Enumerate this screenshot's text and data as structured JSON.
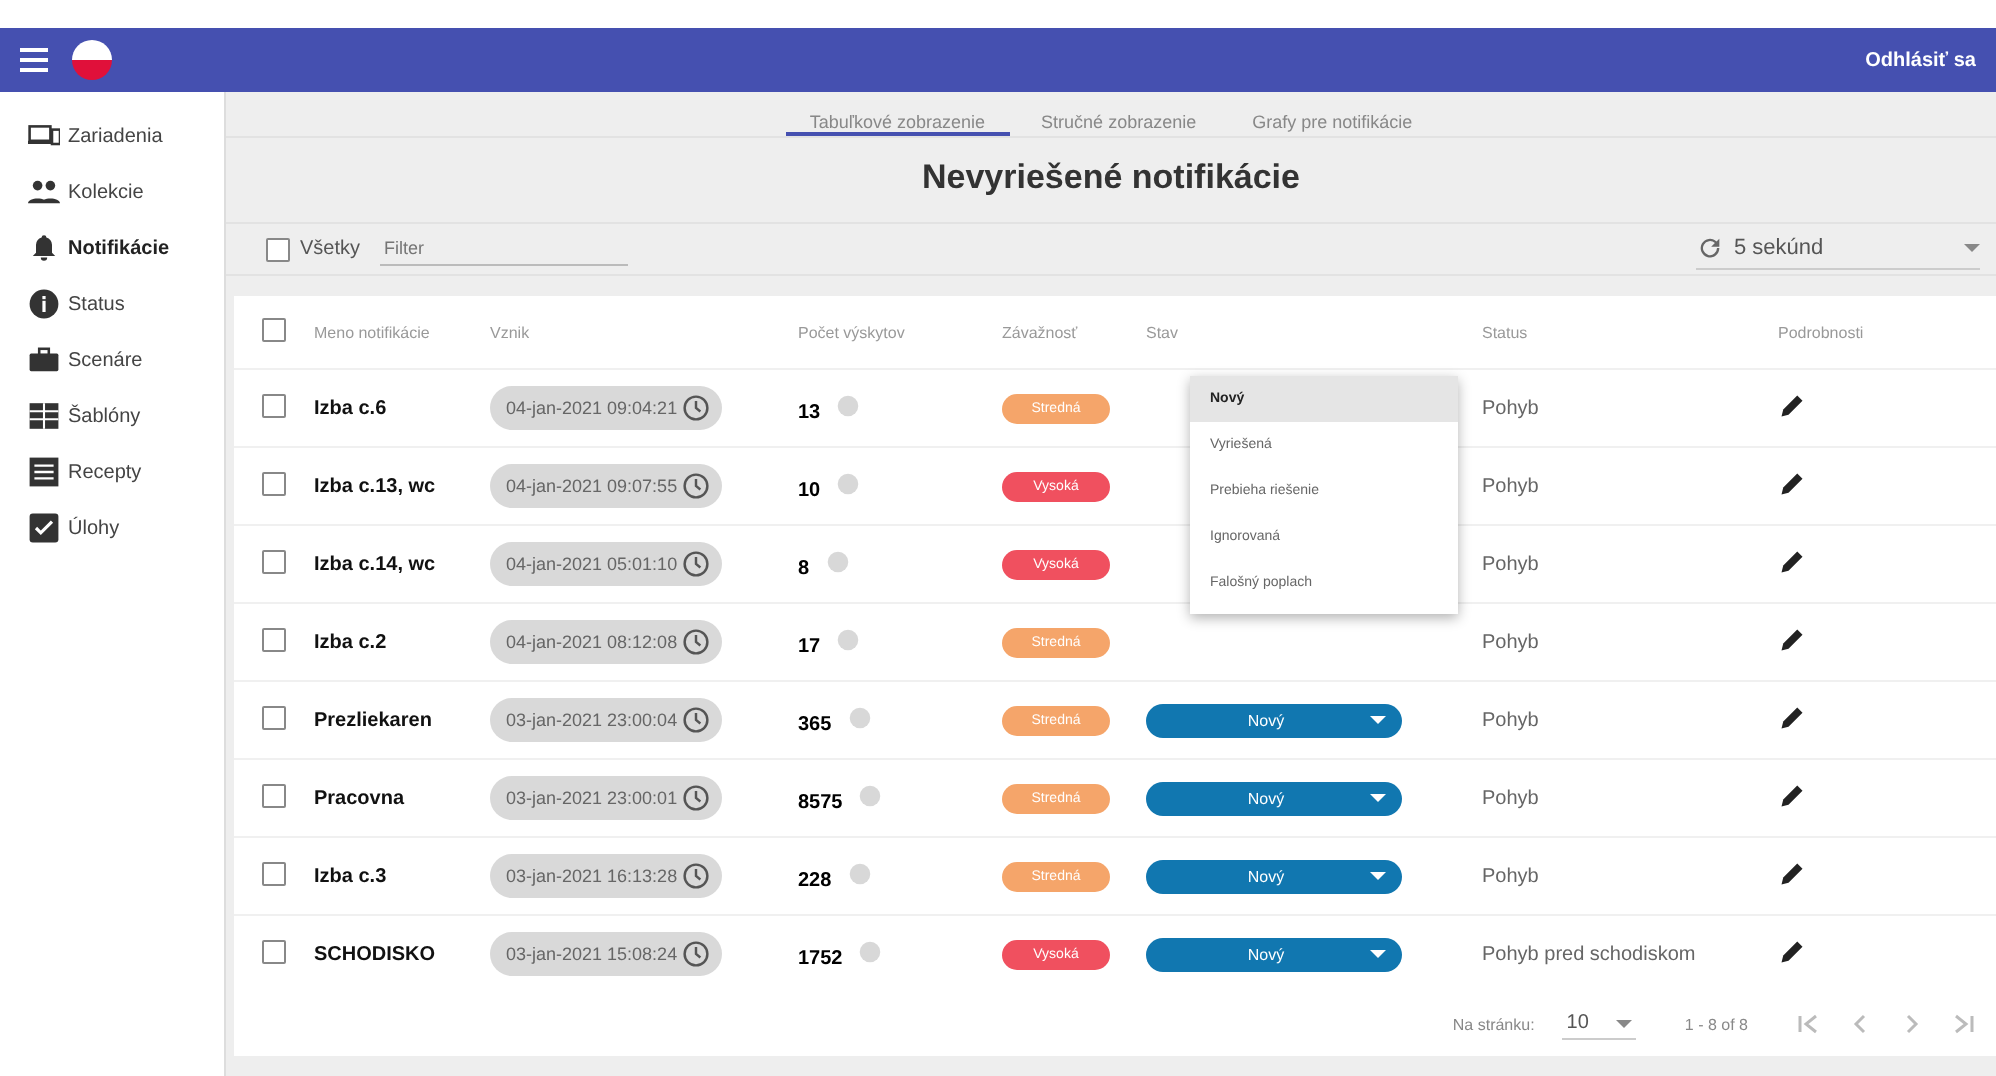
{
  "topbar": {
    "logout": "Odhlásiť sa"
  },
  "sidebar": {
    "items": [
      {
        "label": "Zariadenia",
        "selected": false
      },
      {
        "label": "Kolekcie",
        "selected": false
      },
      {
        "label": "Notifikácie",
        "selected": true
      },
      {
        "label": "Status",
        "selected": false
      },
      {
        "label": "Scenáre",
        "selected": false
      },
      {
        "label": "Šablóny",
        "selected": false
      },
      {
        "label": "Recepty",
        "selected": false
      },
      {
        "label": "Úlohy",
        "selected": false
      }
    ]
  },
  "tabs": [
    {
      "label": "Tabuľkové zobrazenie",
      "selected": true
    },
    {
      "label": "Stručné zobrazenie",
      "selected": false
    },
    {
      "label": "Grafy pre notifikácie",
      "selected": false
    }
  ],
  "title": "Nevyriešené notifikácie",
  "filter": {
    "all_label": "Všetky",
    "all_checked": false,
    "placeholder": "Filter",
    "refresh": "5 sekúnd"
  },
  "table": {
    "all_rows_checked": false,
    "columns": [
      "Meno notifikácie",
      "Vznik",
      "Počet výskytov",
      "Závažnosť",
      "Stav",
      "Status",
      "Podrobnosti"
    ],
    "rows": [
      {
        "checked": false,
        "name": "Izba c.6",
        "time": "04-jan-2021 09:04:21",
        "count": "13",
        "severity": {
          "label": "Stredná",
          "color": "#f5a56a"
        },
        "status": "Pohyb"
      },
      {
        "checked": false,
        "name": "Izba c.13, wc",
        "time": "04-jan-2021 09:07:55",
        "count": "10",
        "severity": {
          "label": "Vysoká",
          "color": "#f0505f"
        },
        "status": "Pohyb"
      },
      {
        "checked": false,
        "name": "Izba c.14, wc",
        "time": "04-jan-2021 05:01:10",
        "count": "8",
        "severity": {
          "label": "Vysoká",
          "color": "#f0505f"
        },
        "status": "Pohyb"
      },
      {
        "checked": false,
        "name": "Izba c.2",
        "time": "04-jan-2021 08:12:08",
        "count": "17",
        "severity": {
          "label": "Stredná",
          "color": "#f5a56a"
        },
        "status": "Pohyb"
      },
      {
        "checked": false,
        "name": "Prezliekaren",
        "time": "03-jan-2021 23:00:04",
        "count": "365",
        "severity": {
          "label": "Stredná",
          "color": "#f5a56a"
        },
        "stav": "Nový",
        "status": "Pohyb"
      },
      {
        "checked": false,
        "name": "Pracovna",
        "time": "03-jan-2021 23:00:01",
        "count": "8575",
        "severity": {
          "label": "Stredná",
          "color": "#f5a56a"
        },
        "stav": "Nový",
        "status": "Pohyb"
      },
      {
        "checked": false,
        "name": "Izba c.3",
        "time": "03-jan-2021 16:13:28",
        "count": "228",
        "severity": {
          "label": "Stredná",
          "color": "#f5a56a"
        },
        "stav": "Nový",
        "status": "Pohyb"
      },
      {
        "checked": false,
        "name": "SCHODISKO",
        "time": "03-jan-2021 15:08:24",
        "count": "1752",
        "severity": {
          "label": "Vysoká",
          "color": "#f0505f"
        },
        "stav": "Nový",
        "status": "Pohyb pred schodiskom"
      }
    ]
  },
  "stav_menu": [
    {
      "label": "Nový",
      "selected": true
    },
    {
      "label": "Vyriešená",
      "selected": false
    },
    {
      "label": "Prebieha riešenie",
      "selected": false
    },
    {
      "label": "Ignorovaná",
      "selected": false
    },
    {
      "label": "Falošný poplach",
      "selected": false
    }
  ],
  "paginator": {
    "label": "Na stránku:",
    "page_size": "10",
    "range": "1 - 8 of 8"
  }
}
